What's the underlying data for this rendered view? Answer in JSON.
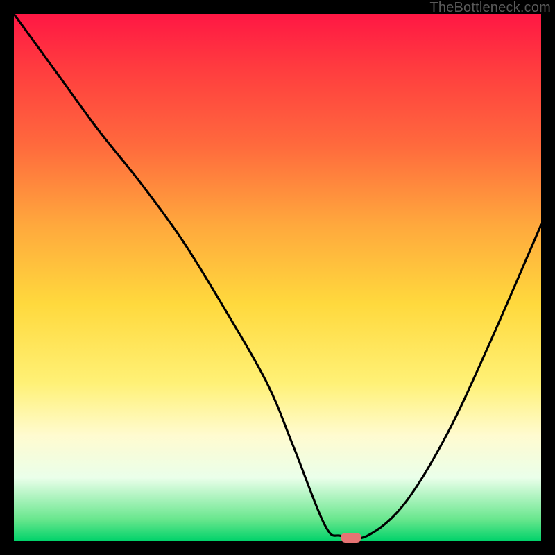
{
  "watermark": "TheBottleneck.com",
  "chart_data": {
    "type": "line",
    "title": "",
    "xlabel": "",
    "ylabel": "",
    "xlim": [
      0,
      100
    ],
    "ylim": [
      0,
      100
    ],
    "series": [
      {
        "name": "curve",
        "x": [
          0,
          8,
          16,
          24,
          32,
          40,
          48,
          53,
          59,
          62,
          67,
          74,
          82,
          90,
          100
        ],
        "values": [
          100,
          89,
          78,
          68,
          57,
          44,
          30,
          18,
          3,
          1,
          1,
          7,
          20,
          37,
          60
        ]
      }
    ],
    "marker": {
      "x": 64,
      "y": 0.7
    },
    "background_gradient": {
      "top": "#ff1744",
      "mid": "#ffd93d",
      "bottom": "#00d26a"
    }
  }
}
